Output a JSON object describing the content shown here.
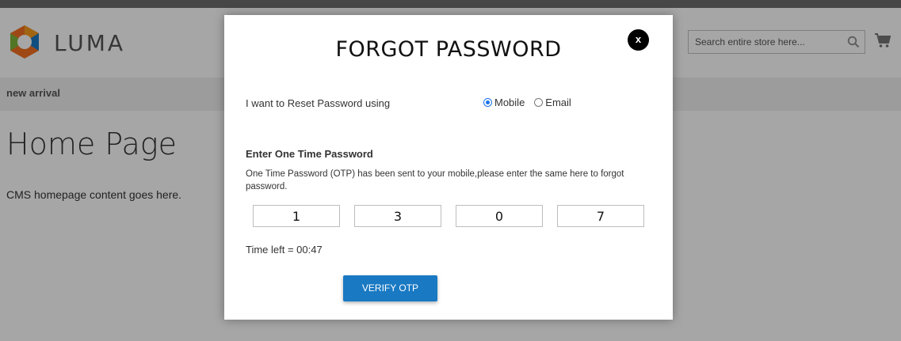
{
  "colors": {
    "overlay": "#000000",
    "accent": "#1979c3",
    "close_button": "#000000",
    "nav_bg": "#f0f0f0"
  },
  "header": {
    "logo_text": "LUMA",
    "search": {
      "placeholder": "Search entire store here...",
      "value": ""
    },
    "search_icon": "search-icon",
    "cart_icon": "cart-icon"
  },
  "nav": {
    "items": [
      {
        "label": "new arrival"
      }
    ]
  },
  "page": {
    "title": "Home Page",
    "content": "CMS homepage content goes here."
  },
  "modal": {
    "title": "FORGOT PASSWORD",
    "close_label": "x",
    "reset_label": "I want to Reset Password using",
    "options": [
      {
        "label": "Mobile",
        "checked": true
      },
      {
        "label": "Email",
        "checked": false
      }
    ],
    "otp_heading": "Enter One Time Password",
    "otp_description": "One Time Password (OTP) has been sent to your mobile,please enter the same here to forgot password.",
    "otp_digits": [
      "1",
      "3",
      "0",
      "7"
    ],
    "timer_text": "Time left = 00:47",
    "verify_label": "VERIFY OTP"
  }
}
